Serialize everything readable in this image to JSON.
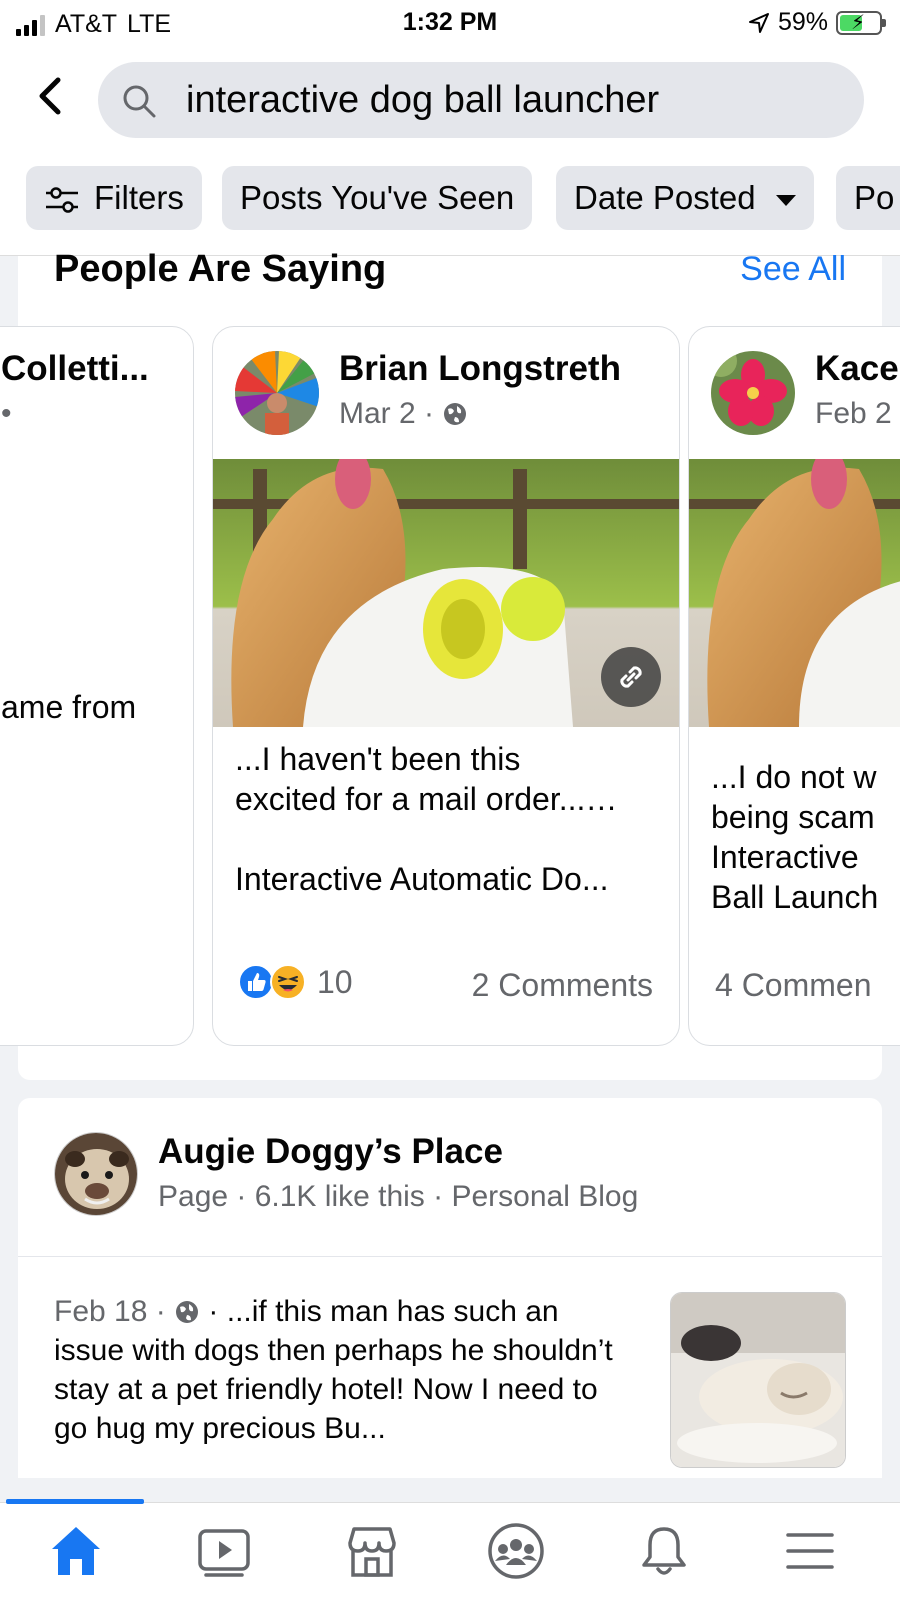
{
  "status_bar": {
    "carrier": "AT&T",
    "network": "LTE",
    "time": "1:32 PM",
    "battery_percent": "59%",
    "battery_level": 0.59,
    "icons": [
      "signal-icon",
      "location-arrow-icon",
      "battery-charging-icon"
    ]
  },
  "search": {
    "query": "interactive dog ball launcher"
  },
  "filters": {
    "chips": [
      {
        "label": "Filters",
        "icon": "sliders-icon"
      },
      {
        "label": "Posts You've Seen"
      },
      {
        "label": "Date Posted",
        "icon": "caret-down-icon"
      },
      {
        "label": "Po"
      }
    ]
  },
  "people_are_saying": {
    "title": "People Are Saying",
    "see_all": "See All",
    "posts": [
      {
        "author": "Colletti...",
        "meta": "•",
        "snippet": "ame from"
      },
      {
        "author": "Brian Longstreth",
        "date": "Mar 2 ·",
        "visibility_icon": "globe-icon",
        "snippet": "...I haven't been this\nexcited for a mail order...…\n\nInteractive Automatic Do...",
        "reaction_count": "10",
        "reactions": [
          "like-icon",
          "haha-icon"
        ],
        "comments": "2 Comments"
      },
      {
        "author": "Kace",
        "date": "Feb 2",
        "snippet": "...I do not w\nbeing scam\nInteractive\nBall Launch",
        "comments": "4 Commen"
      }
    ]
  },
  "page_result": {
    "name": "Augie Doggy’s Place",
    "meta": "Page · 6.1K like this · Personal Blog",
    "post_date": "Feb 18 ·",
    "post_text": "· ...if this man has such an issue with dogs then perhaps he shouldn’t stay at a pet friendly hotel! Now I need to go hug my precious Bu..."
  },
  "tabbar": {
    "items": [
      "home-icon",
      "video-icon",
      "marketplace-icon",
      "groups-icon",
      "notifications-icon",
      "menu-icon"
    ],
    "active": "home-icon"
  },
  "colors": {
    "accent": "#1877f2",
    "surface": "#ffffff",
    "background": "#f0f2f5",
    "secondary_text": "#65676b",
    "chip_bg": "#e4e6eb"
  }
}
